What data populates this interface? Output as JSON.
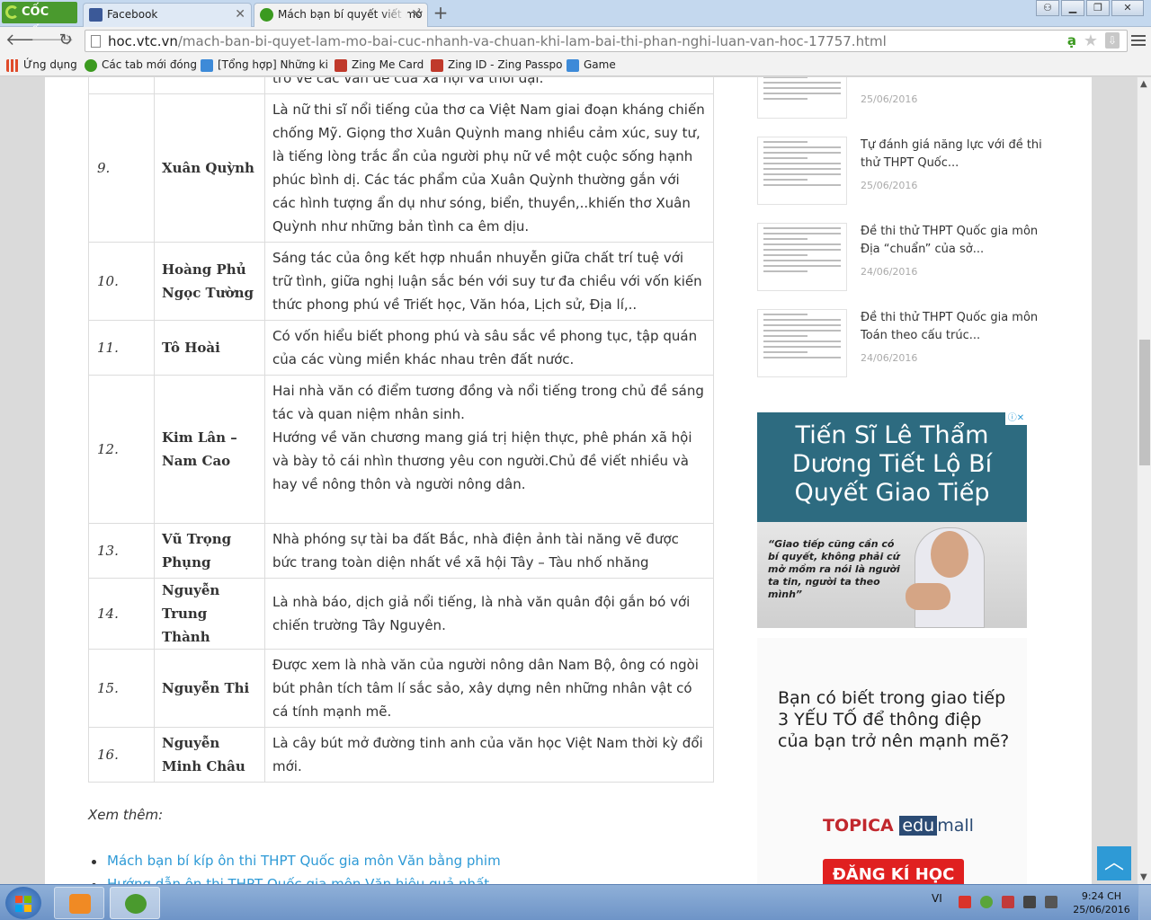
{
  "browser": {
    "logo_text": "CỐC CỐC",
    "tabs": [
      {
        "label": "Facebook",
        "color": "#3b5998"
      },
      {
        "label": "Mách bạn bí quyết viết mở",
        "color": "#3b9a1f"
      }
    ],
    "window_buttons": {
      "user": "⚇",
      "minimize": "▁",
      "restore": "❐",
      "close": "✕"
    },
    "url_domain": "hoc.vtc.vn",
    "url_path": "/mach-ban-bi-quyet-lam-mo-bai-cuc-nhanh-va-chuan-khi-lam-bai-thi-phan-nghi-luan-van-hoc-17757.html",
    "bookmarks": [
      {
        "label": "Ứng dụng",
        "color": "#e04b2a"
      },
      {
        "label": "Các tab mới đóng",
        "color": "#3b9a1f"
      },
      {
        "label": "[Tổng hợp] Những ki",
        "color": "#3d8ad8"
      },
      {
        "label": "Zing Me Card",
        "color": "#c0392b"
      },
      {
        "label": "Zing ID - Zing Passpo",
        "color": "#c0392b"
      },
      {
        "label": "Game",
        "color": "#3d8ad8"
      }
    ]
  },
  "article": {
    "partial_top": "trở về các vấn đề của xã hội và thời đại.",
    "rows": [
      {
        "num": "9.",
        "name": "Xuân Quỳnh",
        "desc": "Là nữ thi sĩ nổi tiếng của thơ ca Việt Nam giai đoạn kháng chiến chống Mỹ. Giọng thơ Xuân Quỳnh mang nhiều cảm xúc, suy tư, là tiếng lòng trắc ẩn của người phụ nữ về một cuộc sống hạnh phúc bình dị. Các tác phẩm của Xuân Quỳnh thường gắn với các hình tượng ẩn dụ như sóng, biển, thuyền,..khiến thơ Xuân Quỳnh như những bản tình ca êm dịu."
      },
      {
        "num": "10.",
        "name": "Hoàng Phủ Ngọc Tường",
        "desc": "Sáng tác của ông kết hợp nhuần nhuyễn giữa chất trí tuệ với trữ tình, giữa nghị luận sắc bén với suy tư đa chiều với vốn kiến thức phong phú về Triết học, Văn hóa, Lịch sử, Địa lí,.."
      },
      {
        "num": "11.",
        "name": "Tô Hoài",
        "desc": "Có vốn hiểu biết phong phú và sâu sắc về phong tục, tập quán của các vùng miền khác nhau trên đất nước."
      },
      {
        "num": "12.",
        "name": "Kim Lân – Nam Cao",
        "desc": "Hai nhà văn có điểm tương đồng và nổi tiếng trong chủ đề sáng tác và quan niệm nhân sinh.",
        "desc2": "Hướng về văn chương mang giá trị hiện thực, phê phán xã hội và bày tỏ cái nhìn thương yêu con người.Chủ đề viết nhiều và hay về nông thôn và người nông dân."
      },
      {
        "num": "13.",
        "name": "Vũ Trọng Phụng",
        "desc": "Nhà phóng sự tài ba đất Bắc, nhà điện ảnh tài năng vẽ được bức trang toàn diện nhất về xã hội Tây – Tàu nhố nhăng"
      },
      {
        "num": "14.",
        "name": "Nguyễn Trung Thành",
        "desc": "Là nhà báo, dịch giả nổi tiếng, là nhà văn quân đội gắn bó với chiến trường Tây Nguyên."
      },
      {
        "num": "15.",
        "name": "Nguyễn Thi",
        "desc": "Được xem là nhà văn của người nông dân Nam Bộ, ông có ngòi bút  phân tích tâm lí sắc sảo, xây dựng nên những nhân vật có cá tính mạnh mẽ."
      },
      {
        "num": "16.",
        "name": "Nguyễn Minh Châu",
        "desc": "Là cây bút mở đường tinh anh của văn học Việt Nam thời kỳ đổi mới."
      }
    ],
    "see_more": "Xem thêm:",
    "links": [
      "Mách bạn bí kíp ôn thi THPT Quốc gia môn Văn bằng phim",
      "Hướng dẫn ôn thi THPT Quốc gia môn Văn hiệu quả nhất"
    ]
  },
  "sidebar": {
    "items": [
      {
        "title": "",
        "date": "25/06/2016"
      },
      {
        "title": "Tự đánh giá năng lực với đề thi thử THPT Quốc...",
        "date": "25/06/2016"
      },
      {
        "title": "Đề thi thử THPT Quốc gia môn Địa “chuẩn” của sở...",
        "date": "24/06/2016"
      },
      {
        "title": "Đề thi thử THPT Quốc gia môn Toán theo cấu trúc...",
        "date": "24/06/2016"
      }
    ],
    "ad1": {
      "title": "Tiến Sĩ Lê Thẩm Dương Tiết Lộ Bí Quyết Giao Tiếp",
      "quote": "“Giao tiếp cũng cần có bí quyết, không phải cứ mở mồm ra nói là người ta tin, người ta theo mình”",
      "badge": "ⓘ✕"
    },
    "ad2": {
      "text": "Bạn có biết trong giao tiếp 3 YẾU TỐ để thông điệp của bạn trở nên mạnh mẽ?",
      "brand_a": "TOPICA",
      "brand_b": "edu",
      "brand_c": "mall",
      "cta": "ĐĂNG KÍ HỌC"
    }
  },
  "taskbar": {
    "lang": "VI",
    "time": "9:24 CH",
    "date": "25/06/2016"
  }
}
